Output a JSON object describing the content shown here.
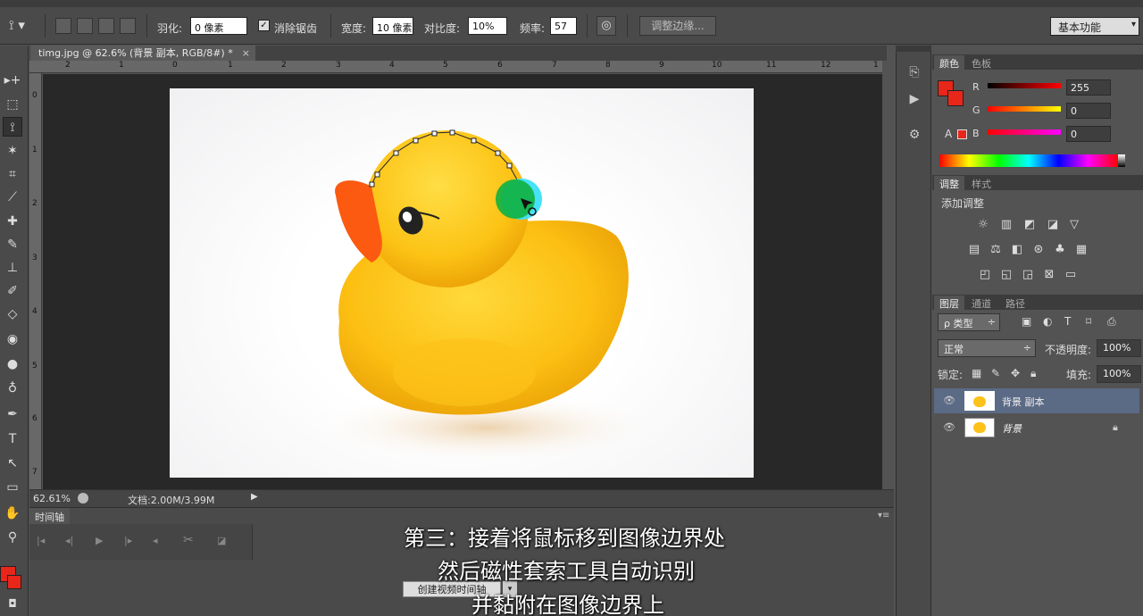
{
  "options_bar": {
    "feather_label": "羽化:",
    "feather_value": "0 像素",
    "antialias_label": "消除锯齿",
    "width_label": "宽度:",
    "width_value": "10 像素",
    "contrast_label": "对比度:",
    "contrast_value": "10%",
    "frequency_label": "频率:",
    "frequency_value": "57",
    "refine_edge_button": "调整边缘...",
    "workspace": "基本功能"
  },
  "document": {
    "tab_title": "timg.jpg @ 62.6% (背景 副本, RGB/8#) *",
    "close": "×",
    "ruler_top": [
      "2",
      "1",
      "0",
      "1",
      "2",
      "3",
      "4",
      "5",
      "6",
      "7",
      "8",
      "9",
      "10",
      "11",
      "12",
      "1"
    ],
    "ruler_left": [
      "0",
      "1",
      "2",
      "3",
      "4",
      "5",
      "6",
      "7"
    ]
  },
  "status_bar": {
    "zoom": "62.61%",
    "doc_size": "文档:2.00M/3.99M"
  },
  "timeline": {
    "tab_label": "时间轴",
    "create_button": "创建视频时间轴"
  },
  "subtitles": [
    "第三：接着将鼠标移到图像边界处",
    "然后磁性套索工具自动识别",
    "并黏附在图像边界上"
  ],
  "panels": {
    "color_tabs": [
      "颜色",
      "色板"
    ],
    "color": {
      "r_label": "R",
      "r_value": "255",
      "g_label": "G",
      "g_value": "0",
      "b_label": "B",
      "b_value": "0",
      "foreground_color": "#e8261a"
    },
    "adjust_tabs": [
      "调整",
      "样式"
    ],
    "adjust_title": "添加调整",
    "layers_tabs": [
      "图层",
      "通道",
      "路径"
    ],
    "layer_filter": "ρ 类型",
    "blend_mode": "正常",
    "opacity_label": "不透明度:",
    "opacity_value": "100%",
    "lock_label": "锁定:",
    "fill_label": "填充:",
    "fill_value": "100%",
    "layers": [
      {
        "name": "背景 副本",
        "selected": true
      },
      {
        "name": "背景",
        "selected": false
      }
    ]
  }
}
